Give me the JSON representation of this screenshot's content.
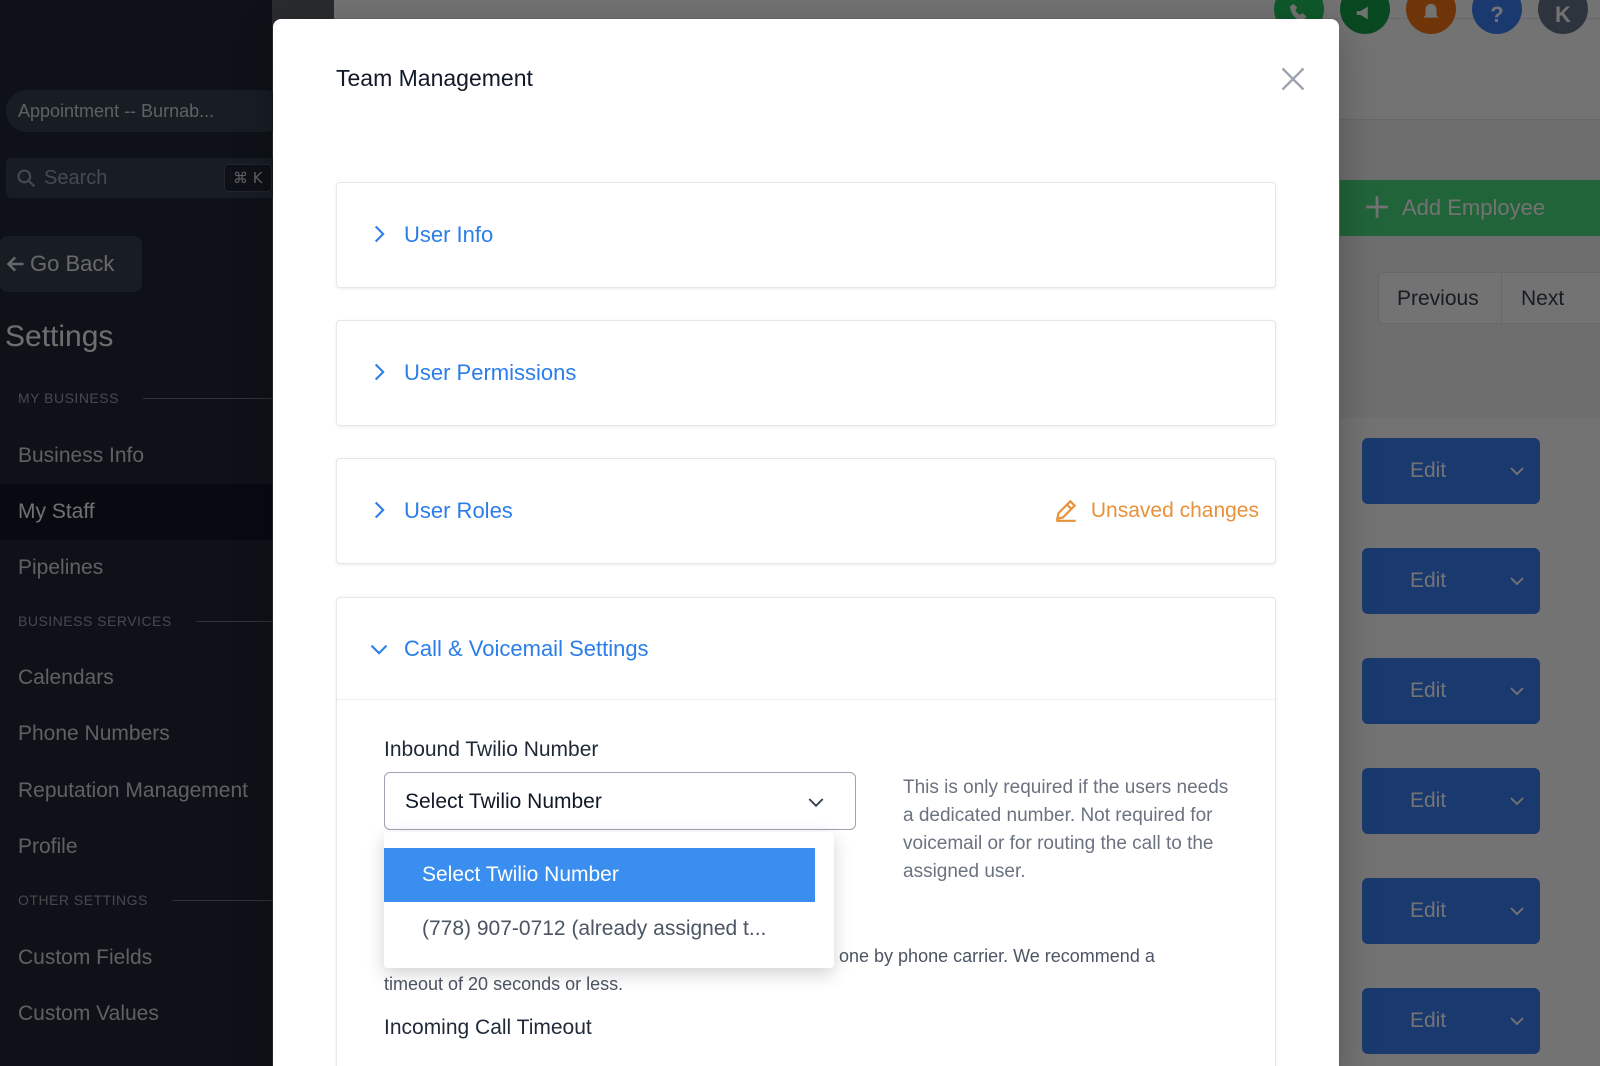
{
  "sidebar": {
    "location": "Appointment -- Burnab...",
    "search_placeholder": "Search",
    "search_shortcut": "⌘ K",
    "go_back": "Go Back",
    "title": "Settings",
    "sections": [
      {
        "label": "MY BUSINESS",
        "items": [
          "Business Info",
          "My Staff",
          "Pipelines"
        ]
      },
      {
        "label": "BUSINESS SERVICES",
        "items": [
          "Calendars",
          "Phone Numbers",
          "Reputation Management",
          "Profile"
        ]
      },
      {
        "label": "OTHER SETTINGS",
        "items": [
          "Custom Fields",
          "Custom Values"
        ]
      }
    ],
    "active_item": "My Staff"
  },
  "topbar": {
    "avatar_initials": "K",
    "icons": [
      "phone-icon",
      "megaphone-icon",
      "bell-icon",
      "help-icon"
    ],
    "colors": [
      "#22c55e",
      "#16a34a",
      "#f97316",
      "#3b82f6",
      "#64748b"
    ]
  },
  "main": {
    "add_employee": "Add Employee",
    "pager": {
      "previous": "Previous",
      "next": "Next"
    },
    "edit_label": "Edit"
  },
  "modal": {
    "title": "Team Management",
    "sections": {
      "user_info": "User Info",
      "user_permissions": "User Permissions",
      "user_roles": "User Roles",
      "call_voicemail": "Call & Voicemail Settings"
    },
    "unsaved_changes": "Unsaved changes",
    "inbound_label": "Inbound Twilio Number",
    "select_value": "Select Twilio Number",
    "help_text": "This is only required if the users needs a dedicated number. Not required for voicemail or for routing the call to the assigned user.",
    "note_text_visible_tail": "one by phone carrier. We recommend a",
    "note_text_line2": "timeout of 20 seconds or less.",
    "incoming_timeout_label": "Incoming Call Timeout",
    "dropdown_options": [
      "Select Twilio Number",
      "(778) 907-0712 (already assigned t..."
    ]
  },
  "colors": {
    "accent": "#2b7de9",
    "warning": "#e89138",
    "selected_option": "#3a8ef0"
  }
}
